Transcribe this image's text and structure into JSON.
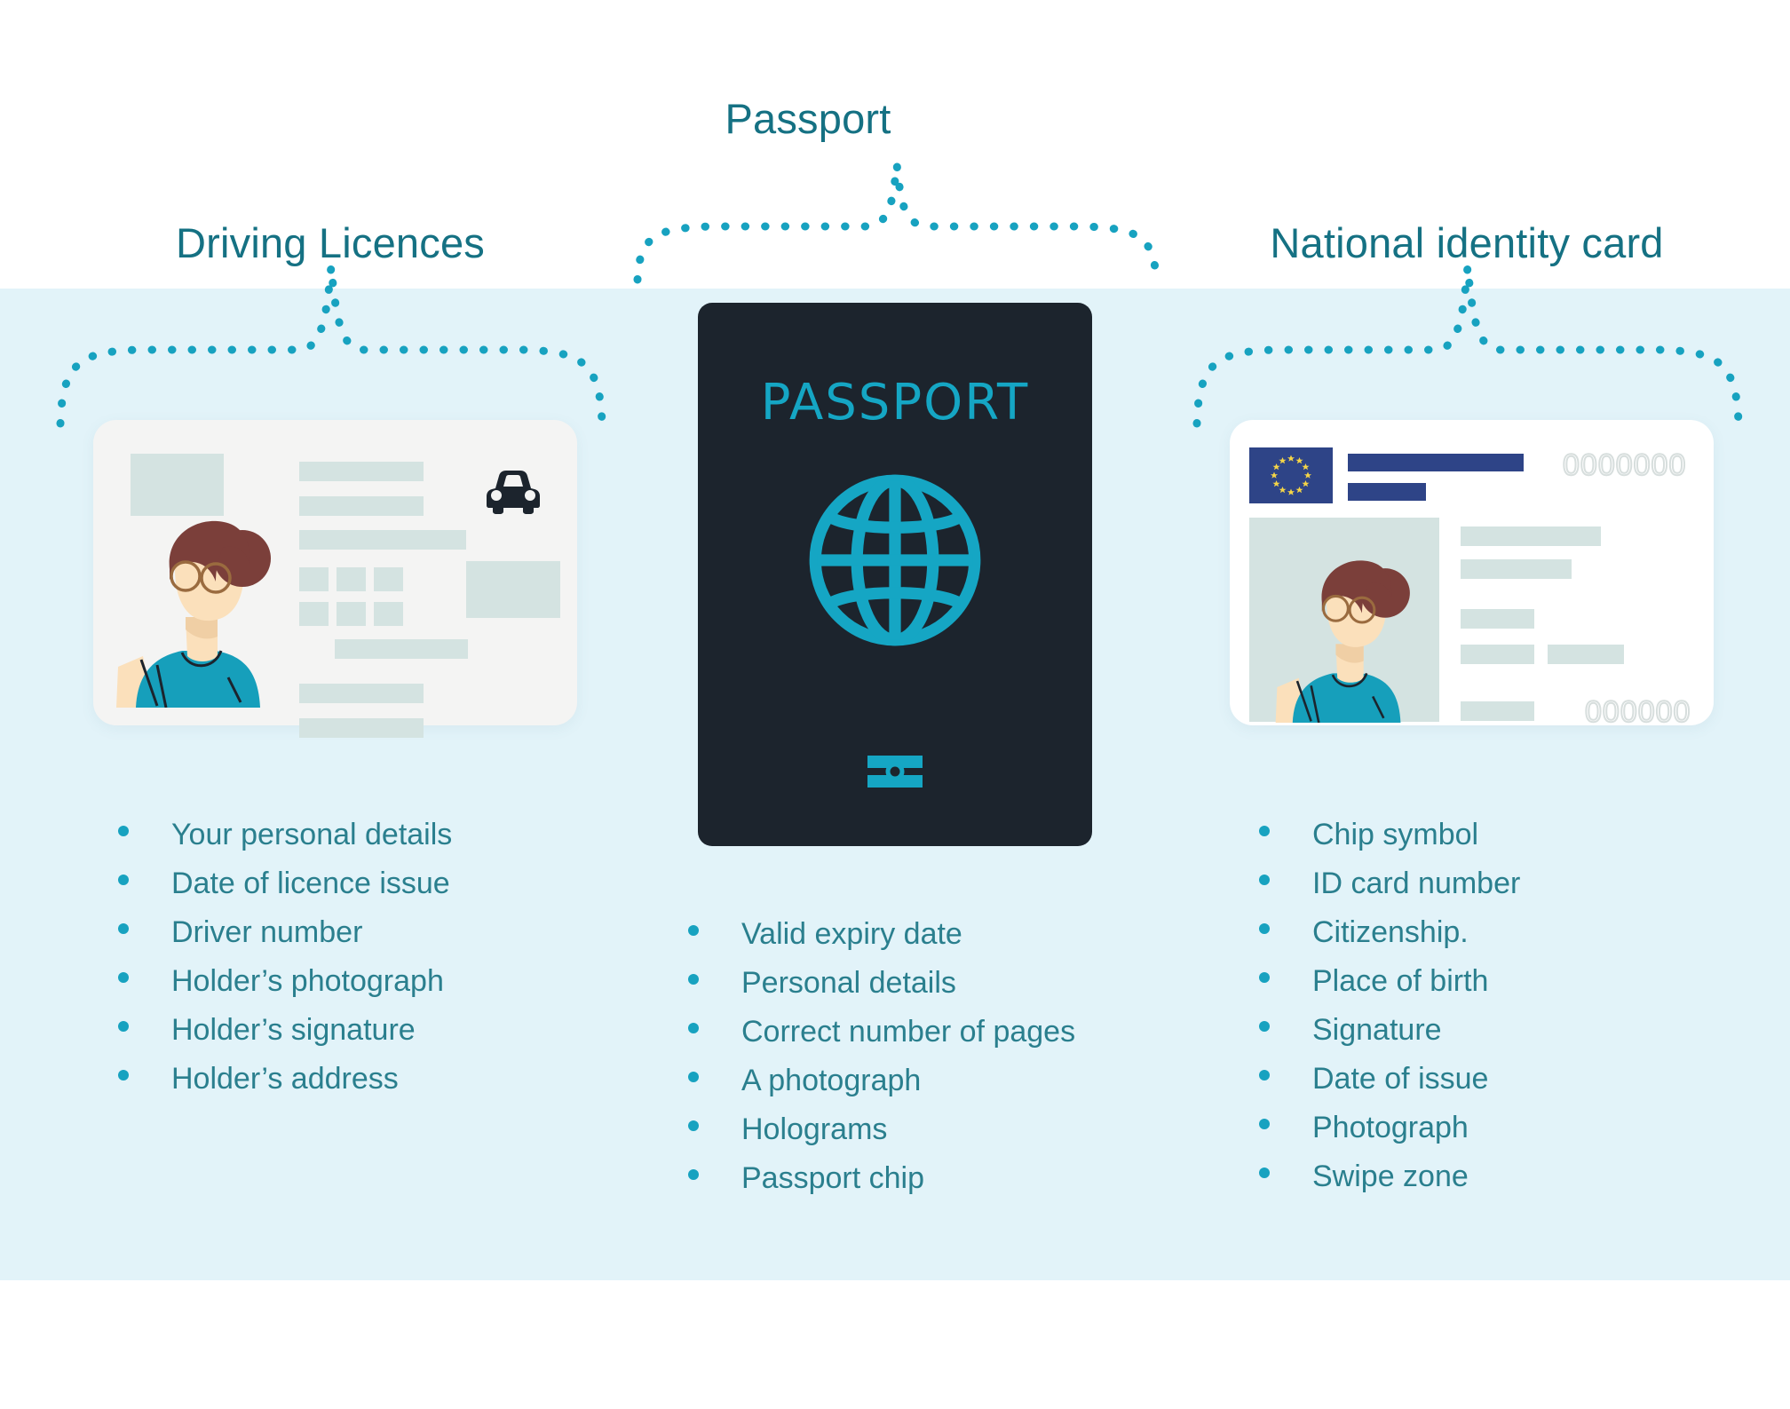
{
  "colors": {
    "band_background": "#e2f3f9",
    "page_background": "#ffffff",
    "heading_text": "#157183",
    "bullet_text": "#2a7f8e",
    "bullet_dot": "#17a2c0",
    "brace_dot": "#17a2c0",
    "passport_cover": "#1c242d",
    "passport_accent": "#15a6c4",
    "card_grey_bar": "#d4e3e1",
    "eu_flag_blue": "#2e4487",
    "eu_flag_star": "#f5d547",
    "id_blue_bar": "#2e4487",
    "avatar_hair": "#7b3f3a",
    "avatar_skin": "#fbe0bb",
    "avatar_shirt": "#169fbb",
    "car_icon": "#1c242d",
    "outline_number": "#d7dedd"
  },
  "columns": {
    "driving": {
      "heading": "Driving Licences",
      "illustration": {
        "name": "driving-licence-card",
        "icons": [
          "car-icon",
          "avatar-portrait"
        ]
      },
      "items": [
        "Your personal details",
        "Date of licence issue",
        "Driver number",
        "Holder’s photograph",
        "Holder’s signature",
        "Holder’s address"
      ]
    },
    "passport": {
      "heading": "Passport",
      "illustration": {
        "name": "passport-book",
        "cover_title": "PASSPORT",
        "icons": [
          "globe-icon",
          "biometric-chip-icon"
        ]
      },
      "items": [
        "Valid expiry date",
        "Personal details",
        "Correct number of pages",
        "A photograph",
        "Holograms",
        "Passport chip"
      ]
    },
    "identity": {
      "heading": "National identity card",
      "illustration": {
        "name": "national-identity-card",
        "icons": [
          "eu-flag-icon",
          "avatar-portrait"
        ],
        "card_number_top": "0000000",
        "card_number_bottom": "000000"
      },
      "items": [
        "Chip symbol",
        "ID card number",
        "Citizenship.",
        "Place of birth",
        "Signature",
        "Date of issue",
        "Photograph",
        "Swipe zone"
      ]
    }
  }
}
